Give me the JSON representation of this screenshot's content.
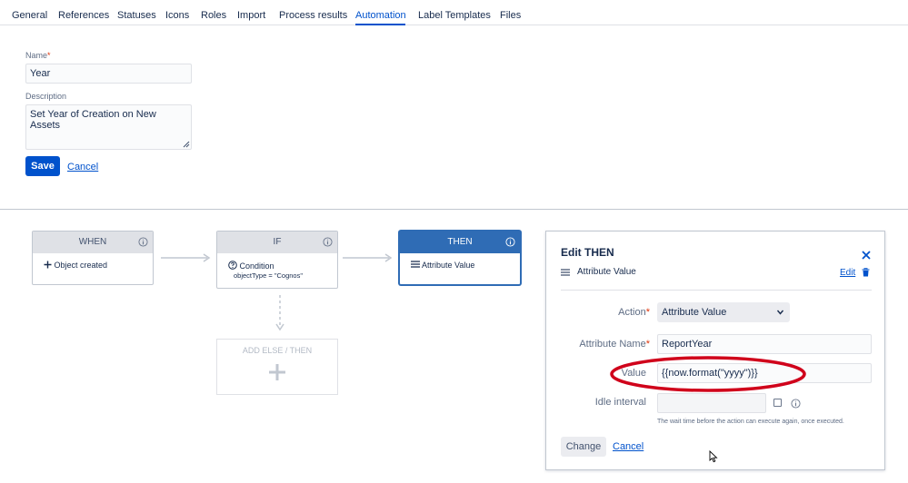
{
  "tabs": [
    {
      "label": "General"
    },
    {
      "label": "References"
    },
    {
      "label": "Statuses"
    },
    {
      "label": "Icons"
    },
    {
      "label": "Roles"
    },
    {
      "label": "Import"
    },
    {
      "label": "Process results"
    },
    {
      "label": "Automation",
      "active": true
    },
    {
      "label": "Label Templates"
    },
    {
      "label": "Files"
    }
  ],
  "form": {
    "name_label": "Name",
    "required_mark": "*",
    "name_value": "Year",
    "description_label": "Description",
    "description_value": "Set Year of Creation on New Assets",
    "save_label": "Save",
    "cancel_label": "Cancel"
  },
  "flow": {
    "when": {
      "title": "WHEN",
      "item": "Object created"
    },
    "if": {
      "title": "IF",
      "item": "Condition",
      "detail": "objectType = \"Cognos\""
    },
    "then": {
      "title": "THEN",
      "item": "Attribute Value"
    },
    "add": {
      "title": "ADD ELSE / THEN"
    }
  },
  "panel": {
    "title": "Edit THEN",
    "component_label": "Attribute Value",
    "edit_link": "Edit",
    "action_label": "Action",
    "action_value": "Attribute Value",
    "attr_name_label": "Attribute Name",
    "attr_name_value": "ReportYear",
    "value_label": "Value",
    "value_value": "{{now.format(\"yyyy\")}}",
    "idle_label": "Idle interval",
    "idle_value": "",
    "idle_hint": "The wait time before the action can execute again, once executed.",
    "change_label": "Change",
    "cancel_label": "Cancel"
  },
  "colors": {
    "accent": "#0052cc",
    "then_header": "#2f6cb5",
    "highlight": "#d0021b",
    "required": "#de350b"
  },
  "icons": [
    "info-icon",
    "plus-icon",
    "question-circle-icon",
    "list-icon",
    "close-icon",
    "trash-icon",
    "chevron-down-icon",
    "mouse-cursor-icon"
  ]
}
